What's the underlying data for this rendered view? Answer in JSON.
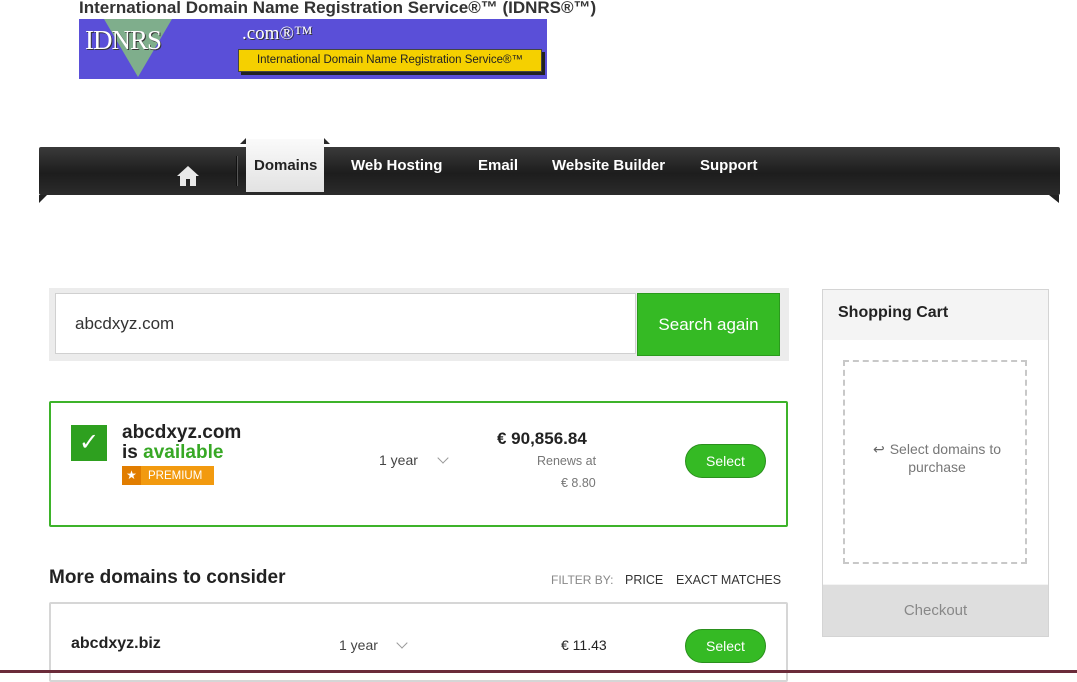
{
  "site": {
    "title": "International Domain Name Registration Service®™ (IDNRS®™)",
    "logo": {
      "mark": "IDNRS",
      "suffix": ".com®™",
      "tagline": "International Domain Name Registration Service®™"
    }
  },
  "nav": {
    "home_icon": "home-icon",
    "items": [
      {
        "label": "Domains",
        "active": true
      },
      {
        "label": "Web Hosting",
        "active": false
      },
      {
        "label": "Email",
        "active": false
      },
      {
        "label": "Website Builder",
        "active": false
      },
      {
        "label": "Support",
        "active": false
      }
    ]
  },
  "search": {
    "value": "abcdxyz.com",
    "button_label": "Search again"
  },
  "result": {
    "domain": "abcdxyz.com",
    "status_prefix": "is",
    "status": "available",
    "badge": "PREMIUM",
    "term": "1 year",
    "price": "€ 90,856.84",
    "renews_label": "Renews at",
    "renews_price": "€ 8.80",
    "select_label": "Select"
  },
  "more": {
    "title": "More domains to consider",
    "filter_label": "FILTER BY:",
    "filters": [
      "PRICE",
      "EXACT MATCHES"
    ],
    "rows": [
      {
        "domain": "abcdxyz.biz",
        "term": "1 year",
        "price": "€ 11.43",
        "select_label": "Select"
      }
    ]
  },
  "cart": {
    "title": "Shopping Cart",
    "hint": "Select domains to purchase",
    "checkout_label": "Checkout"
  },
  "colors": {
    "accent_green": "#35ba24",
    "premium_orange": "#f29a0f",
    "nav_dark": "#2b2b2b"
  }
}
